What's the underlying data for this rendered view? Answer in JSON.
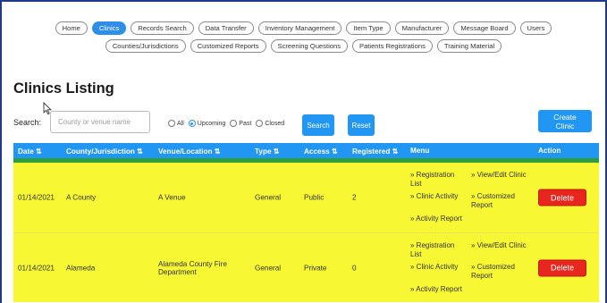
{
  "nav": {
    "row1": [
      "Home",
      "Clinics",
      "Records Search",
      "Data Transfer",
      "Inventory Management",
      "Item Type",
      "Manufacturer",
      "Message Board",
      "Users"
    ],
    "row2": [
      "Counties/Jurisdictions",
      "Customized Reports",
      "Screening Questions",
      "Patients Registrations",
      "Training Material"
    ],
    "active": "Clinics"
  },
  "page": {
    "title": "Clinics Listing"
  },
  "search": {
    "label": "Search:",
    "placeholder": "County or venue name",
    "filters": [
      {
        "label": "All",
        "selected": false
      },
      {
        "label": "Upcoming",
        "selected": true
      },
      {
        "label": "Past",
        "selected": false
      },
      {
        "label": "Closed",
        "selected": false
      }
    ],
    "search_button": "Search",
    "reset_button": "Reset"
  },
  "create_button": "Create Clinic",
  "table": {
    "headers": {
      "date": "Date ⇅",
      "county": "County/Jurisdiction ⇅",
      "venue": "Venue/Location ⇅",
      "type": "Type ⇅",
      "access": "Access ⇅",
      "registered": "Registered ⇅",
      "menu": "Menu",
      "action": "Action"
    },
    "rows": [
      {
        "date": "01/14/2021",
        "county": "A County",
        "venue": "A Venue",
        "type": "General",
        "access": "Public",
        "registered": "2",
        "menu": {
          "registration_list": "» Registration List",
          "view_edit": "» View/Edit Clinic",
          "clinic_activity": "» Clinic Activity",
          "customized_report": "» Customized Report",
          "activity_report": "» Activity Report"
        },
        "action": "Delete"
      },
      {
        "date": "01/14/2021",
        "county": "Alameda",
        "venue": "Alameda County Fire Department",
        "type": "General",
        "access": "Private",
        "registered": "0",
        "menu": {
          "registration_list": "» Registration List",
          "view_edit": "» View/Edit Clinic",
          "clinic_activity": "» Clinic Activity",
          "customized_report": "» Customized Report",
          "activity_report": "» Activity Report"
        },
        "action": "Delete"
      }
    ]
  },
  "colors": {
    "header_blue": "#2196f3",
    "row_yellow": "#f7f734",
    "delete_red": "#e8261e",
    "accent_green": "#2e9e3c"
  }
}
